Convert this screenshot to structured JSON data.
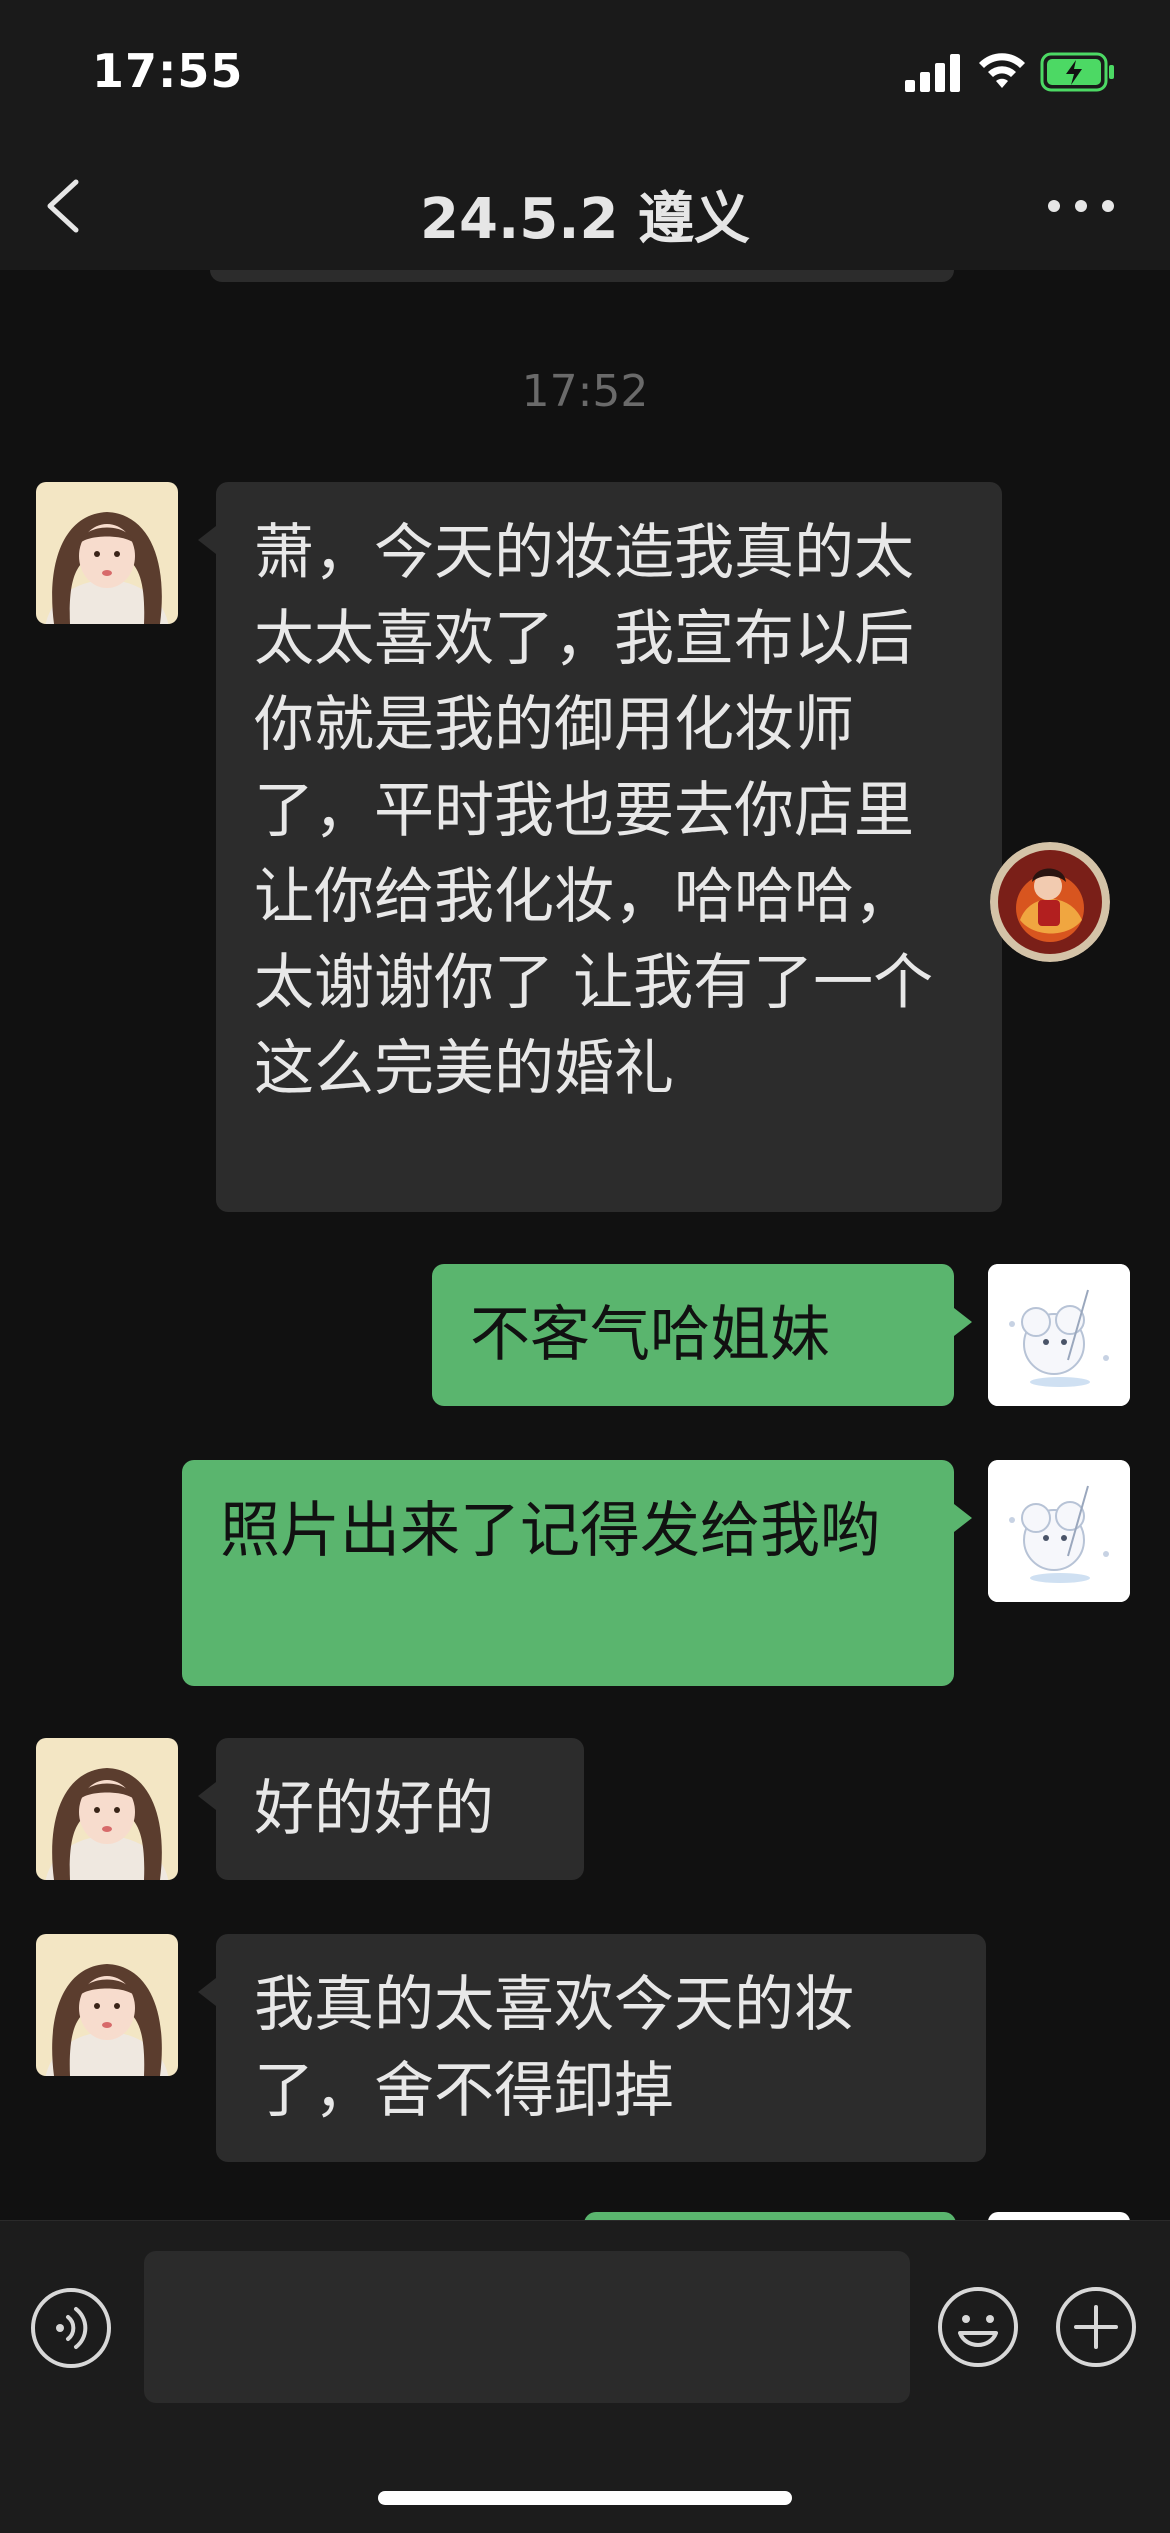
{
  "status_bar": {
    "time": "17:55"
  },
  "header": {
    "title": "24.5.2 遵义"
  },
  "chat": {
    "timestamp": "17:52",
    "messages": [
      {
        "side": "in",
        "text": "萧，今天的妆造我真的太太太喜欢了，我宣布以后你就是我的御用化妆师了，平时我也要去你店里让你给我化妆，哈哈哈，太谢谢你了 让我有了一个这么完美的婚礼"
      },
      {
        "side": "out",
        "text": "不客气哈姐妹"
      },
      {
        "side": "out",
        "text": "照片出来了记得发给我哟"
      },
      {
        "side": "in",
        "text": "好的好的"
      },
      {
        "side": "in",
        "text": "我真的太喜欢今天的妆了，舍不得卸掉"
      }
    ]
  },
  "input_bar": {
    "value": "",
    "placeholder": ""
  },
  "colors": {
    "background": "#111111",
    "bar_background": "#1a1a1a",
    "incoming_bubble": "#2c2c2c",
    "outgoing_bubble": "#5ab56e",
    "battery_green": "#4cd964"
  },
  "icons": [
    "back-icon",
    "more-icon",
    "voice-icon",
    "emoji-icon",
    "plus-icon",
    "signal-icon",
    "wifi-icon",
    "battery-icon"
  ]
}
